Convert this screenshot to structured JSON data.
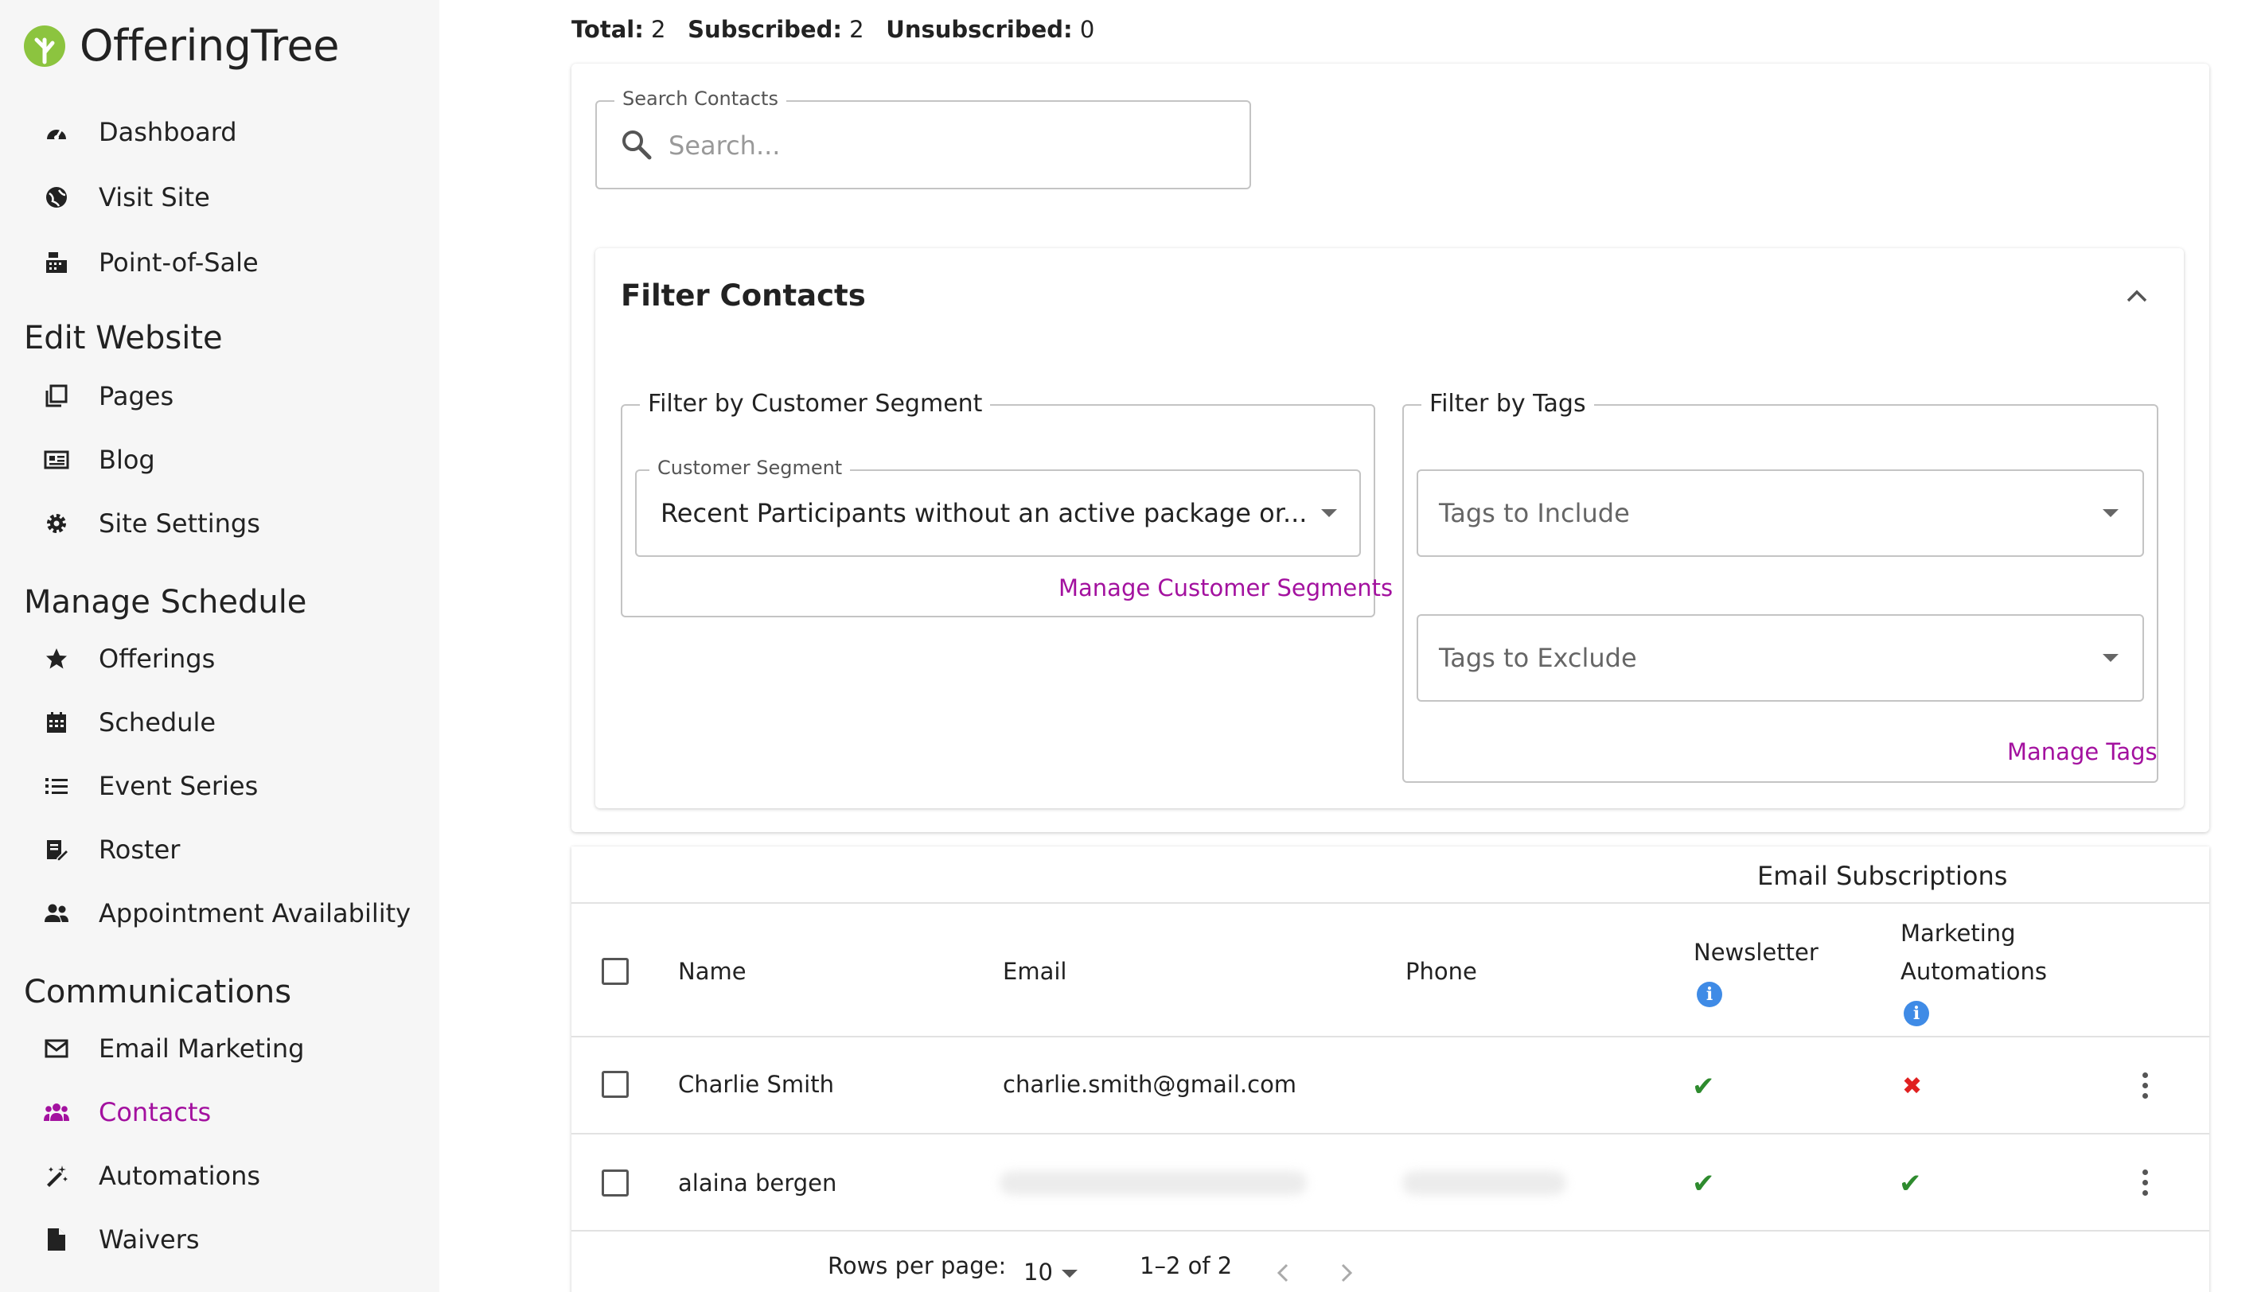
{
  "app": {
    "brand": "OfferingTree"
  },
  "sidebar": {
    "top_items": [
      {
        "label": "Dashboard",
        "icon": "dashboard-gauge-icon"
      },
      {
        "label": "Visit Site",
        "icon": "globe-icon"
      },
      {
        "label": "Point-of-Sale",
        "icon": "cash-register-icon"
      }
    ],
    "sections": [
      {
        "title": "Edit Website",
        "items": [
          {
            "label": "Pages",
            "icon": "pages-icon"
          },
          {
            "label": "Blog",
            "icon": "blog-icon"
          },
          {
            "label": "Site Settings",
            "icon": "gear-icon"
          }
        ]
      },
      {
        "title": "Manage Schedule",
        "items": [
          {
            "label": "Offerings",
            "icon": "star-icon"
          },
          {
            "label": "Schedule",
            "icon": "calendar-icon"
          },
          {
            "label": "Event Series",
            "icon": "list-icon"
          },
          {
            "label": "Roster",
            "icon": "roster-edit-icon"
          },
          {
            "label": "Appointment Availability",
            "icon": "people-icon"
          }
        ]
      },
      {
        "title": "Communications",
        "items": [
          {
            "label": "Email Marketing",
            "icon": "envelope-icon"
          },
          {
            "label": "Contacts",
            "icon": "contacts-group-icon",
            "active": true
          },
          {
            "label": "Automations",
            "icon": "magic-wand-icon"
          },
          {
            "label": "Waivers",
            "icon": "document-icon"
          }
        ]
      }
    ]
  },
  "summary": {
    "total_label": "Total:",
    "total_value": "2",
    "subscribed_label": "Subscribed:",
    "subscribed_value": "2",
    "unsubscribed_label": "Unsubscribed:",
    "unsubscribed_value": "0"
  },
  "search": {
    "label": "Search Contacts",
    "placeholder": "Search..."
  },
  "filter": {
    "title": "Filter Contacts",
    "segment_group_label": "Filter by Customer Segment",
    "segment_field_label": "Customer Segment",
    "segment_value": "Recent Participants without an active package or...",
    "manage_segments": "Manage Customer Segments",
    "tags_group_label": "Filter by Tags",
    "tags_include": "Tags to Include",
    "tags_exclude": "Tags to Exclude",
    "manage_tags": "Manage Tags"
  },
  "table": {
    "group_header": "Email Subscriptions",
    "columns": {
      "name": "Name",
      "email": "Email",
      "phone": "Phone",
      "newsletter": "Newsletter",
      "marketing_line1": "Marketing",
      "marketing_line2": "Automations"
    },
    "rows": [
      {
        "name": "Charlie Smith",
        "email": "charlie.smith@gmail.com",
        "phone": "",
        "newsletter": true,
        "marketing": false
      },
      {
        "name": "alaina bergen",
        "email": "",
        "phone": "",
        "newsletter": true,
        "marketing": true
      }
    ],
    "pagination": {
      "rows_per_page_label": "Rows per page:",
      "rows_per_page": "10",
      "range": "1–2 of 2"
    }
  },
  "colors": {
    "accent": "#a3119f",
    "check": "#2e8b2e",
    "cross": "#e02020",
    "info": "#3f8be6"
  }
}
